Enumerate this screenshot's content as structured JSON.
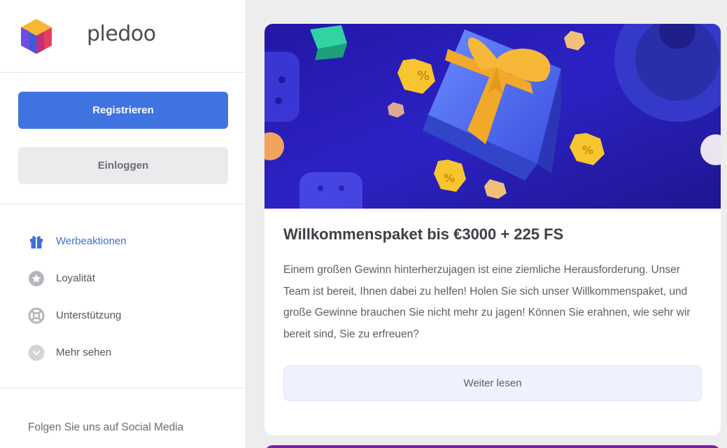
{
  "brand": {
    "name": "pledoo"
  },
  "auth": {
    "register_label": "Registrieren",
    "login_label": "Einloggen"
  },
  "nav": {
    "items": [
      {
        "label": "Werbeaktionen",
        "icon": "gift-icon",
        "active": true
      },
      {
        "label": "Loyalität",
        "icon": "star-icon",
        "active": false
      },
      {
        "label": "Unterstützung",
        "icon": "lifebuoy-icon",
        "active": false
      },
      {
        "label": "Mehr sehen",
        "icon": "chevron-down-icon",
        "active": false
      }
    ]
  },
  "social": {
    "label": "Folgen Sie uns auf Social Media"
  },
  "promo": {
    "title": "Willkommenspaket bis €3000 + 225 FS",
    "text": "Einem großen Gewinn hinterherzujagen ist eine ziemliche Herausforderung. Unser Team ist bereit, Ihnen dabei zu helfen! Holen Sie sich unser Willkommenspaket, und große Gewinne brauchen Sie nicht mehr zu jagen! Können Sie erahnen, wie sehr wir bereit sind, Sie zu erfreuen?",
    "button_label": "Weiter lesen",
    "coin_symbol": "%"
  },
  "colors": {
    "accent": "#3f73e0",
    "active_nav": "#3f6fd8",
    "banner_bg": "#2a1fb0",
    "gift_ribbon": "#f2a92a"
  }
}
